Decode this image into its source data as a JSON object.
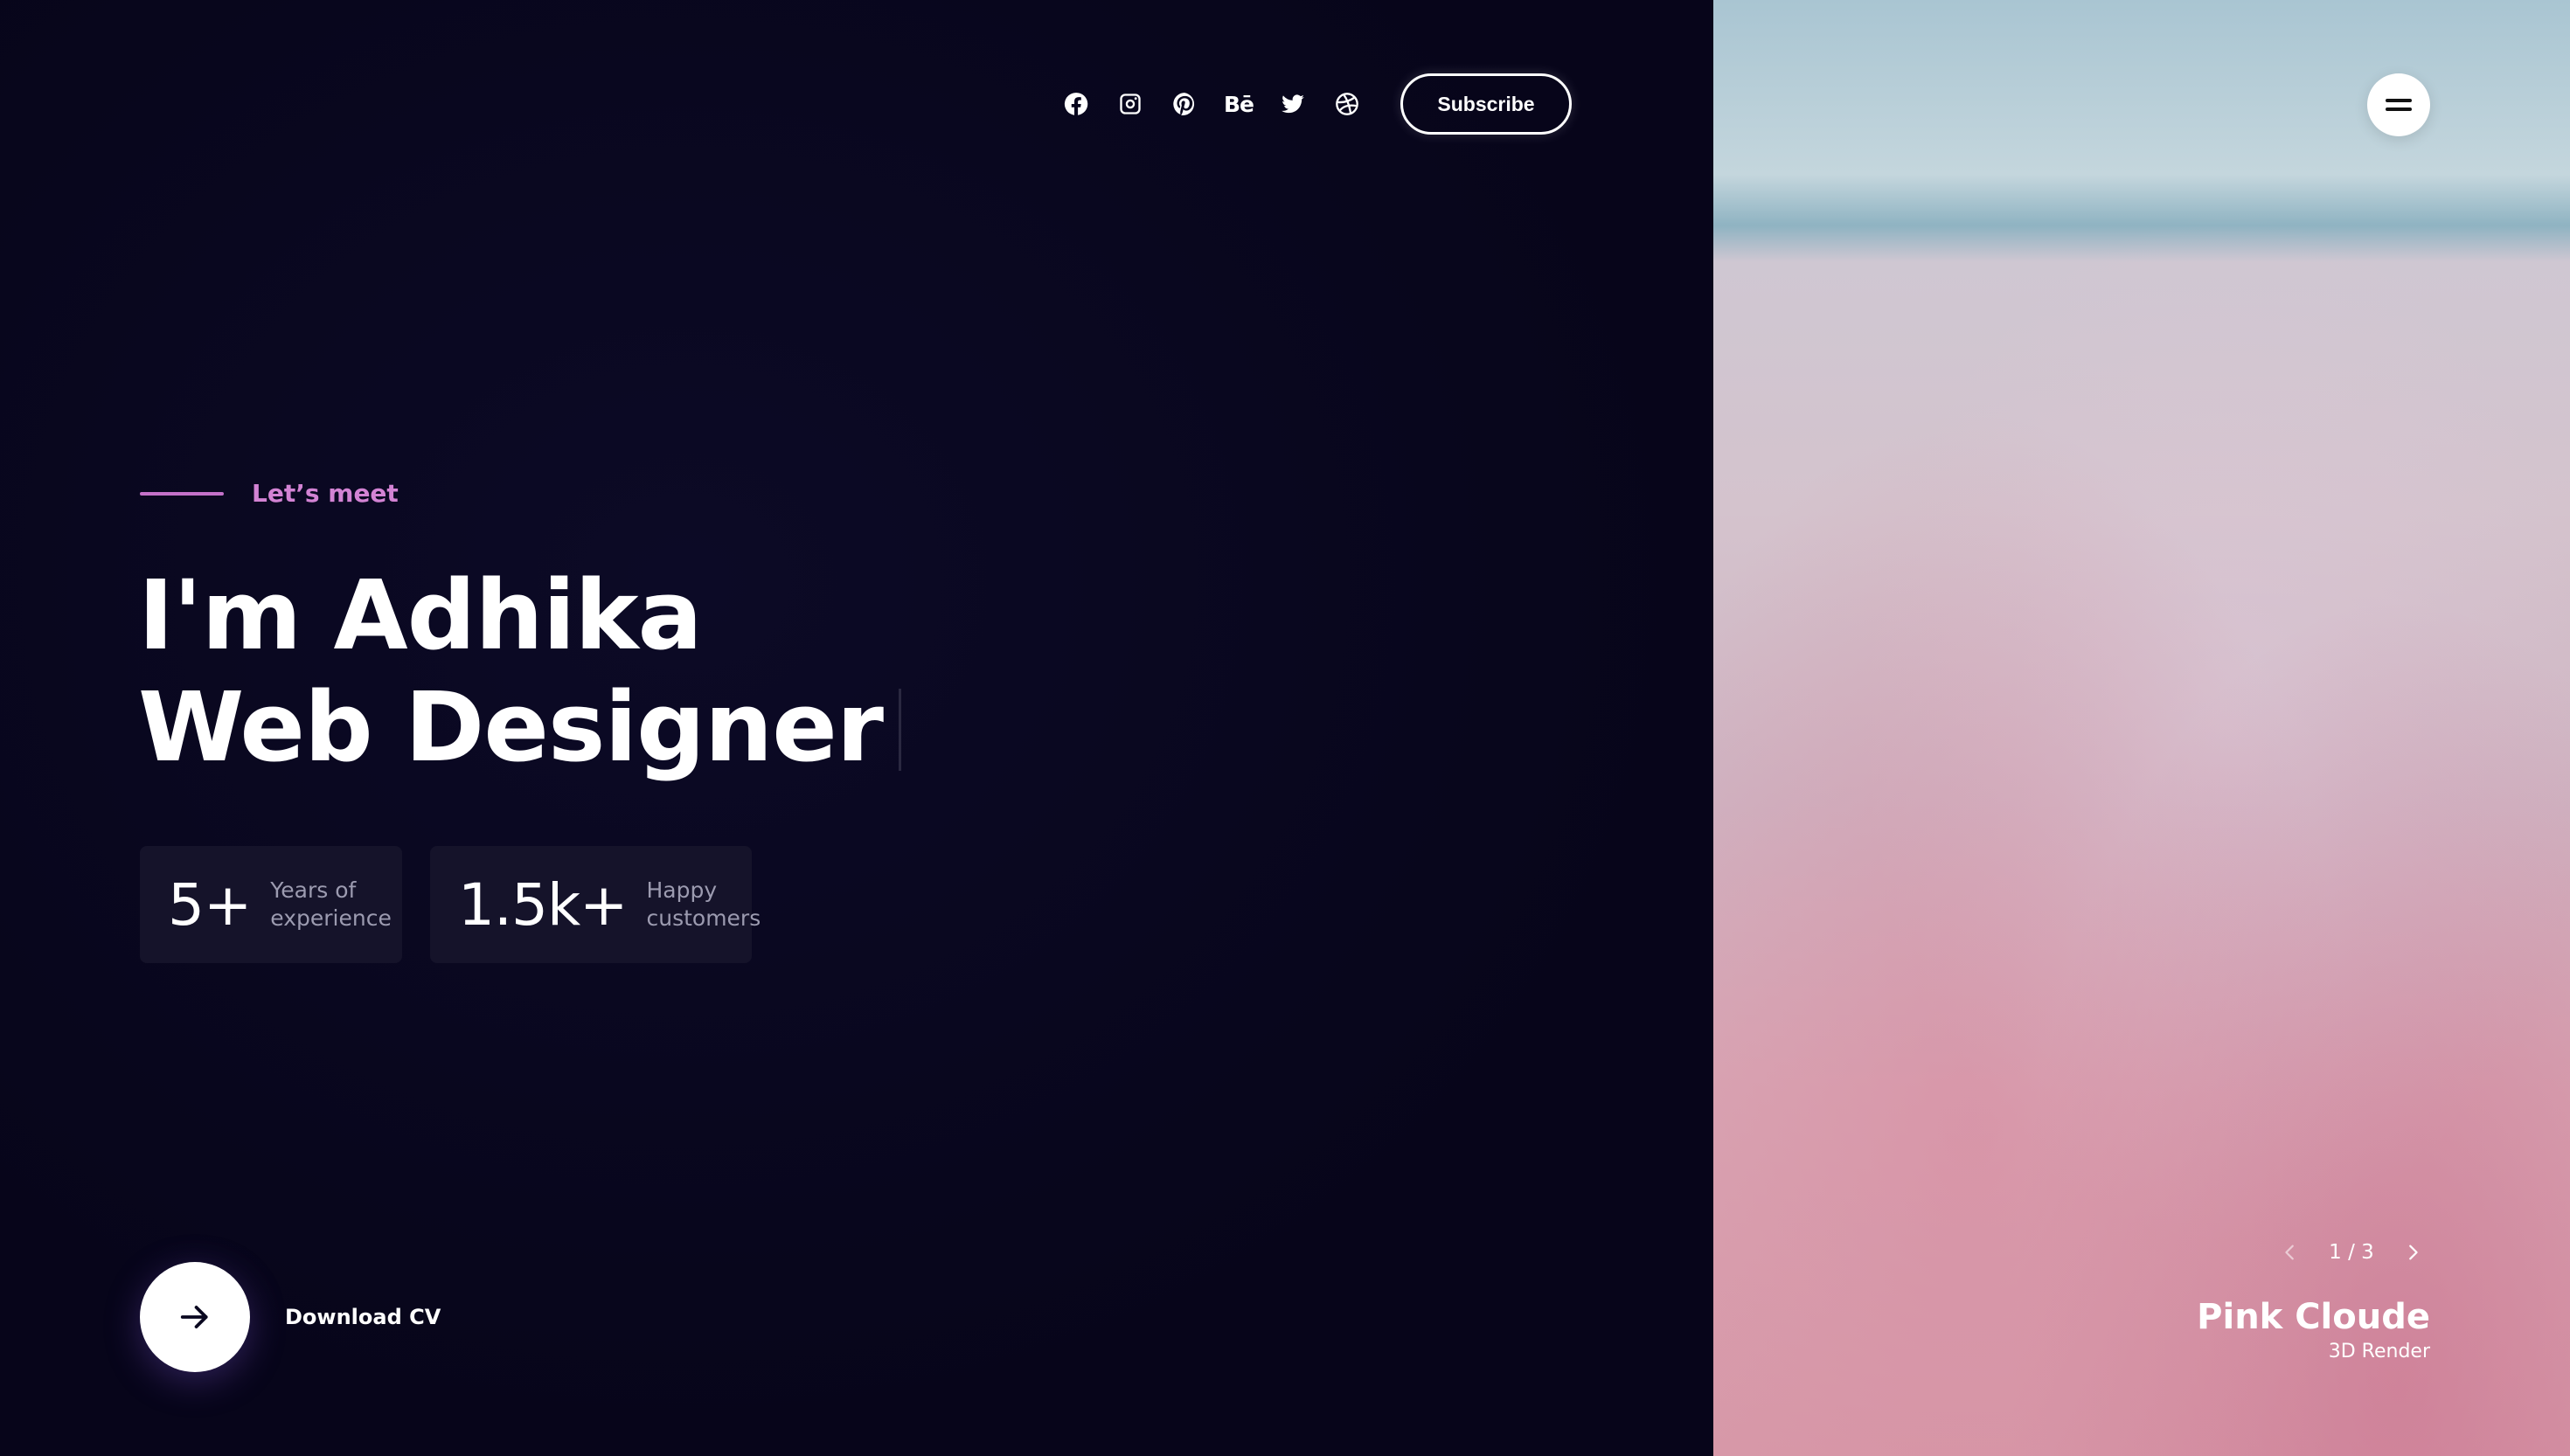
{
  "header": {
    "social": [
      {
        "name": "facebook-icon"
      },
      {
        "name": "instagram-icon"
      },
      {
        "name": "pinterest-icon"
      },
      {
        "name": "behance-icon",
        "text": "Bē"
      },
      {
        "name": "twitter-icon"
      },
      {
        "name": "dribbble-icon"
      }
    ],
    "subscribe_label": "Subscribe",
    "menu_icon": "hamburger-icon"
  },
  "hero": {
    "eyebrow": "Let’s meet",
    "line1": "I'm Adhika",
    "line2": "Web Designer",
    "stats": [
      {
        "value": "5+",
        "label_line1": "Years of",
        "label_line2": "experience"
      },
      {
        "value": "1.5k+",
        "label_line1": "Happy",
        "label_line2": "customers"
      }
    ],
    "download_label": "Download CV",
    "download_icon": "arrow-right-icon"
  },
  "slider": {
    "counter": "1 / 3",
    "title": "Pink Cloude",
    "subtitle": "3D Render",
    "prev_icon": "chevron-left-icon",
    "next_icon": "chevron-right-icon"
  },
  "colors": {
    "background": "#08061c",
    "accent": "#d383d4",
    "card": "#15132a"
  }
}
